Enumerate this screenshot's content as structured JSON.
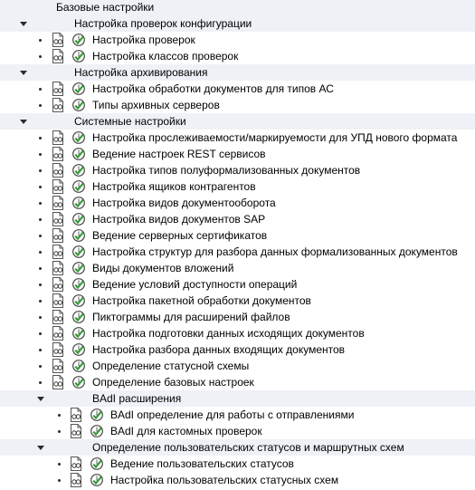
{
  "tree": {
    "root_label": "Базовые настройки",
    "groups": [
      {
        "label": "Настройка проверок конфигурации",
        "items": [
          "Настройка проверок",
          "Настройка классов проверок"
        ]
      },
      {
        "label": "Настройка архивирования",
        "items": [
          "Настройка обработки документов для типов АС",
          "Типы архивных серверов"
        ]
      },
      {
        "label": "Системные настройки",
        "items": [
          "Настройка прослеживаемости/маркируемости для УПД нового формата",
          "Ведение настроек REST сервисов",
          "Настройка типов полуформализованных документов",
          "Настройка ящиков контрагентов",
          "Настройка видов документооборота",
          "Настройка видов документов SAP",
          "Ведение серверных сертификатов",
          "Настройка структур для разбора данных формализованных документов",
          "Виды документов вложений",
          "Ведение условий доступности операций",
          "Настройка пакетной обработки документов",
          "Пиктограммы для расширений файлов",
          "Настройка подготовки данных исходящих документов",
          "Настройка разбора данных входящих документов",
          "Определение статусной схемы",
          "Определение базовых настроек"
        ],
        "subgroups": [
          {
            "label": "BAdI расширения",
            "items": [
              "BAdI определение для работы с отправлениями",
              "BAdI для кастомных проверок"
            ]
          },
          {
            "label": "Определение пользовательских статусов и маршрутных схем",
            "items": [
              "Ведение пользовательских статусов",
              "Настройка пользовательских статусных схем"
            ]
          }
        ]
      }
    ]
  },
  "icons": {
    "item_doc": "document-glasses-icon",
    "item_exec": "execute-clock-check-icon",
    "expanded": "expanded-arrow-icon",
    "bullet": "bullet-icon"
  },
  "colors": {
    "folder_background": "#eef1f6",
    "exec_icon_green": "#3a9a3a"
  }
}
